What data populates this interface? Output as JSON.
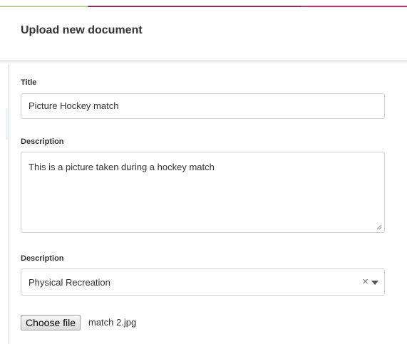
{
  "modal": {
    "title": "Upload new document"
  },
  "form": {
    "title_field": {
      "label": "Title",
      "value": "Picture Hockey match"
    },
    "description_field": {
      "label": "Description",
      "value": "This is a picture taken during a hockey match"
    },
    "category_field": {
      "label": "Description",
      "selected": "Physical Recreation",
      "clear_glyph": "×"
    },
    "file": {
      "button_label": "Choose file",
      "file_name": "match 2.jpg"
    }
  },
  "colors": {
    "accent_green": "#b8d38b",
    "accent_purple": "#8e2a72",
    "accent_pink": "#c0306a",
    "border": "#cfcfcf",
    "text": "#333333"
  }
}
